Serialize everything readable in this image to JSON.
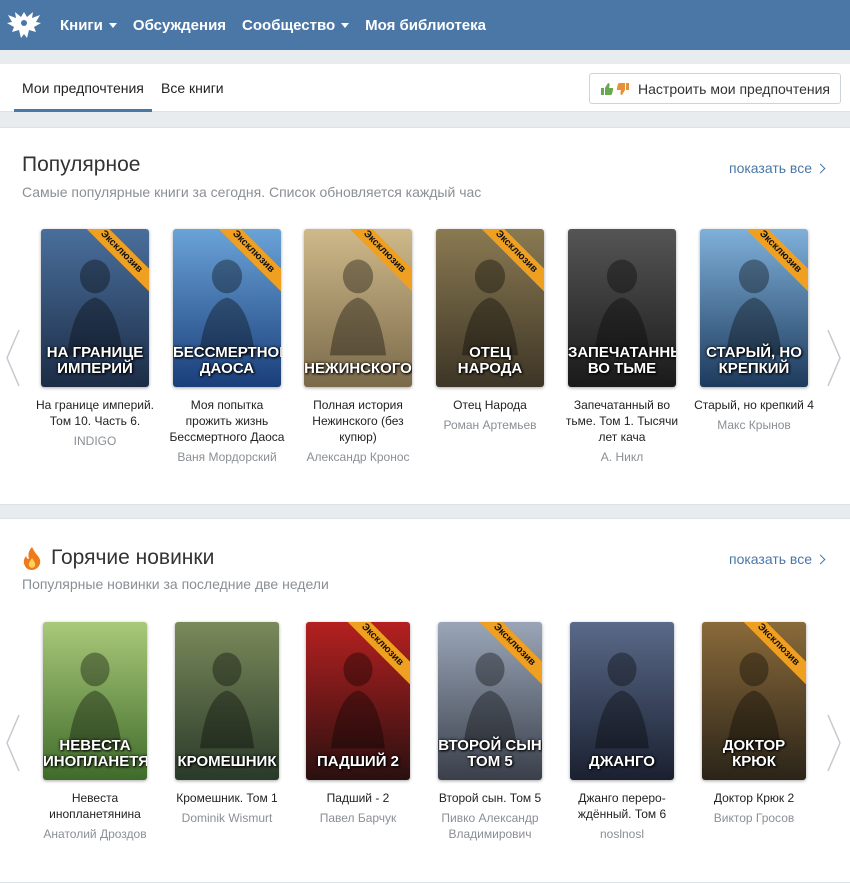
{
  "nav": {
    "items": [
      {
        "label": "Книги",
        "dropdown": true
      },
      {
        "label": "Обсуждения",
        "dropdown": false
      },
      {
        "label": "Сообщество",
        "dropdown": true
      },
      {
        "label": "Моя библиотека",
        "dropdown": false
      }
    ]
  },
  "tabs": {
    "items": [
      "Мои предпочтения",
      "Все книги"
    ],
    "active": "Мои предпочтения",
    "pref_button": "Настроить мои предпочтения"
  },
  "popular": {
    "title": "Популярное",
    "subtitle": "Самые популярные книги за сегодня. Список обновляется каждый час",
    "show_all": "показать все",
    "books": [
      {
        "title": "На границе империй. Том 10. Часть 6.",
        "author": "INDIGO",
        "cover_text": "На границе империй",
        "exclusive": true,
        "badge": "Эксклюзив"
      },
      {
        "title": "Моя попытка прожить жизнь Бессмертного Даоса",
        "author": "Ваня Мордорский",
        "cover_text": "Бессмертного Даоса",
        "exclusive": true,
        "badge": "Эксклюзив"
      },
      {
        "title": "Полная история Нежинского (без купюр)",
        "author": "Александр Кронос",
        "cover_text": "Нежинского",
        "exclusive": true,
        "badge": "Эксклюзив"
      },
      {
        "title": "Отец Народа",
        "author": "Роман Артемьев",
        "cover_text": "Отец Народа",
        "exclusive": true,
        "badge": "Эксклюзив"
      },
      {
        "title": "Запечатанный во тьме. Том 1. Тысячи лет кача",
        "author": "А. Никл",
        "cover_text": "Запечатанный во тьме",
        "exclusive": false,
        "badge": ""
      },
      {
        "title": "Старый, но крепкий 4",
        "author": "Макс Крынов",
        "cover_text": "Старый, но крепкий",
        "exclusive": true,
        "badge": "Эксклюзив"
      }
    ]
  },
  "hot": {
    "title": "Горячие новинки",
    "subtitle": "Популярные новинки за последние две недели",
    "show_all": "показать все",
    "books": [
      {
        "title": "Невеста инопланетянина",
        "author": "Анатолий Дроздов",
        "cover_text": "Невеста инопланетянина",
        "exclusive": false,
        "badge": ""
      },
      {
        "title": "Кромешник. Том 1",
        "author": "Dominik Wismurt",
        "cover_text": "Кромешник",
        "exclusive": false,
        "badge": ""
      },
      {
        "title": "Падший - 2",
        "author": "Павел Барчук",
        "cover_text": "Падший 2",
        "exclusive": true,
        "badge": "Эксклюзив"
      },
      {
        "title": "Второй сын. Том 5",
        "author": "Пивко Александр Владимирович",
        "cover_text": "Второй сын том 5",
        "exclusive": true,
        "badge": "Эксклюзив"
      },
      {
        "title": "Джанго переро-ждённый. Том 6",
        "author": "noslnosl",
        "cover_text": "Джанго",
        "exclusive": false,
        "badge": ""
      },
      {
        "title": "Доктор Крюк 2",
        "author": "Виктор Гросов",
        "cover_text": "Доктор Крюк",
        "exclusive": true,
        "badge": "Эксклюзив"
      }
    ]
  },
  "colors": {
    "header": "#4b77a7",
    "link": "#4b77a7",
    "ribbon": "#f0a020",
    "fire": "#f07a1a"
  },
  "icons": {
    "logo": "eagle-logo-icon",
    "thumbs": [
      "thumbs-up-icon",
      "thumbs-down-icon"
    ],
    "fire": "fire-icon",
    "arrows": [
      "chevron-left-icon",
      "chevron-right-icon"
    ]
  }
}
